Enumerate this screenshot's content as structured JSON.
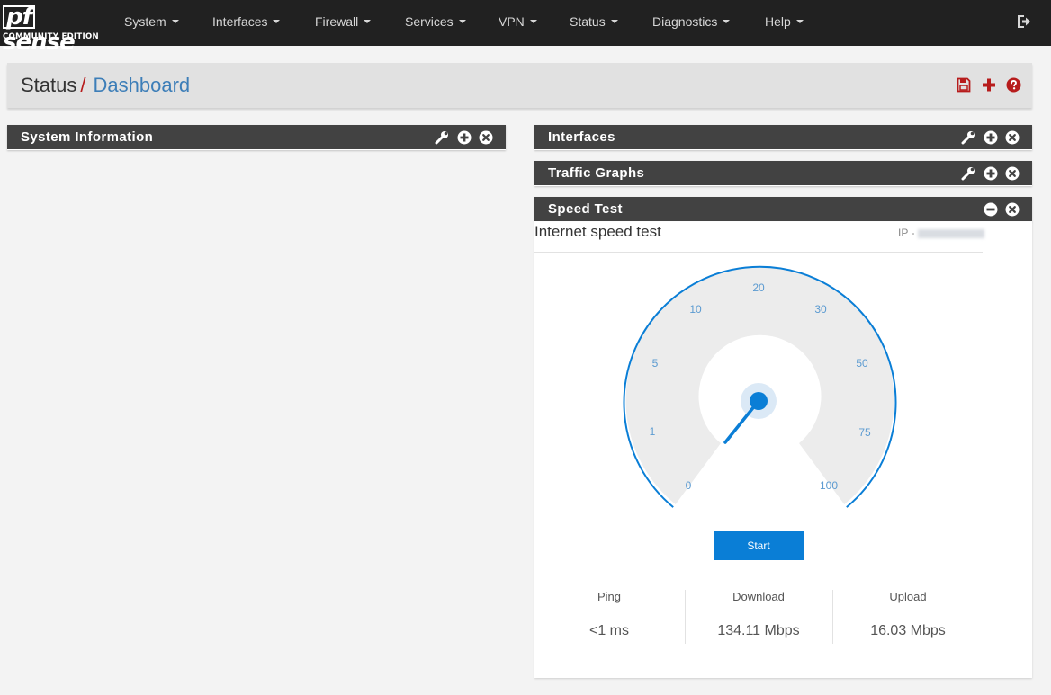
{
  "navbar": {
    "logo_pf": "pf",
    "logo_sense": "sense",
    "logo_edition": "COMMUNITY EDITION",
    "menu": [
      {
        "label": "System"
      },
      {
        "label": "Interfaces"
      },
      {
        "label": "Firewall"
      },
      {
        "label": "Services"
      },
      {
        "label": "VPN"
      },
      {
        "label": "Status"
      },
      {
        "label": "Diagnostics"
      },
      {
        "label": "Help"
      }
    ],
    "logout_icon": "sign-out-icon"
  },
  "breadcrumb": {
    "section": "Status",
    "separator": "/",
    "page": "Dashboard",
    "icons": [
      "save-icon",
      "plus-icon",
      "question-circle-icon"
    ]
  },
  "widgets": {
    "system_information": {
      "title": "System Information"
    },
    "interfaces": {
      "title": "Interfaces"
    },
    "traffic_graphs": {
      "title": "Traffic Graphs"
    },
    "speed_test": {
      "title": "Speed Test",
      "heading": "Internet speed test",
      "ip_label": "IP -",
      "gauge_ticks": [
        "0",
        "1",
        "5",
        "10",
        "20",
        "30",
        "50",
        "75",
        "100"
      ],
      "needle_value_mbps": 0,
      "start_label": "Start",
      "results": [
        {
          "label": "Ping",
          "value": "<1 ms"
        },
        {
          "label": "Download",
          "value": "134.11 Mbps"
        },
        {
          "label": "Upload",
          "value": "16.03 Mbps"
        }
      ]
    }
  },
  "colors": {
    "navbar_bg": "#212121",
    "panel_header_bg": "#424242",
    "link_blue": "#3d7eb8",
    "accent_red": "#b71c1c",
    "gauge_blue": "#0a7ed6"
  }
}
